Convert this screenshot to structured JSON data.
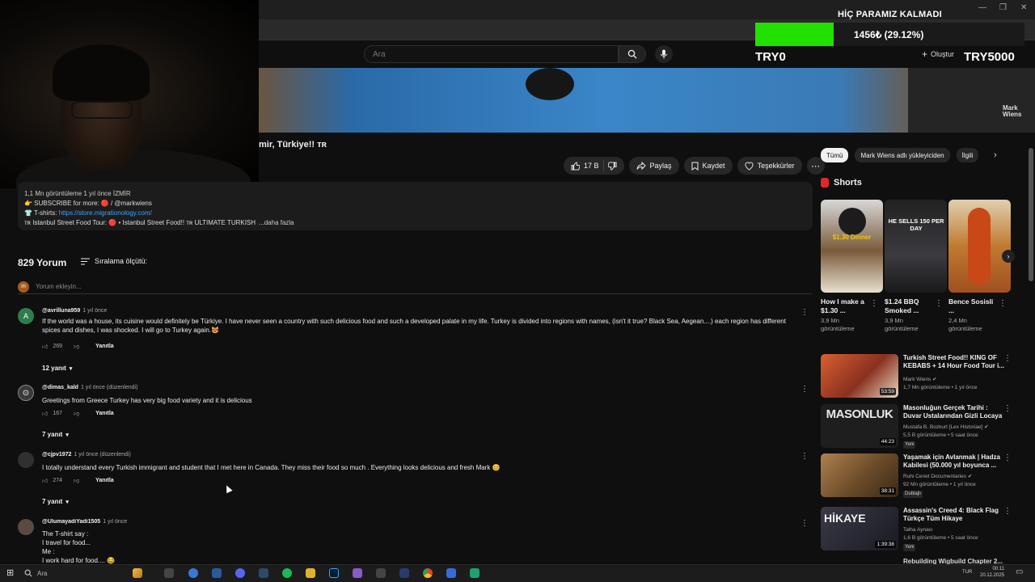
{
  "header": {
    "search_placeholder": "Ara",
    "create_label": "Oluştur"
  },
  "donation": {
    "title": "HİÇ PARAMIZ KALMADI",
    "amount": "1456₺ (29.12%)",
    "progress_fraction": 0.2912,
    "min_label": "TRY0",
    "max_label": "TRY5000",
    "bar_color": "#22e000"
  },
  "video": {
    "watermark": "Mark\nWiens",
    "title": "mir, Türkiye!! ᴛʀ"
  },
  "actions": {
    "likes": "17 B",
    "share": "Paylaş",
    "save": "Kaydet",
    "thanks": "Teşekkürler"
  },
  "description": {
    "meta": "1,1 Mn görüntüleme  1 yıl önce  İZMİR",
    "line1": "👉 SUBSCRIBE for more: 🔴 / @markwiens",
    "line2_label": "👕 T-shirts: ",
    "line2_link": "https://store.migrationology.com/",
    "line3": "ᴛʀ Istanbul Street Food Tour: 🔴 • Istanbul Street Food!! ᴛʀ ULTIMATE TURKISH",
    "more": "...daha fazla"
  },
  "comments": {
    "count_label": "829 Yorum",
    "sort_label": "Sıralama ölçütü:",
    "add_placeholder": "Yorum ekleyin...",
    "user_initial": "m",
    "reply_label": "Yanıtla",
    "items": [
      {
        "initial": "A",
        "author": "@avrilluna959",
        "time": "1 yıl önce",
        "text": "If the world was a house, its cuisine would definitely be Türkiye. I have never seen a country with such delicious food and such a developed palate in my life. Turkey is divided into regions with names, (isn't it true? Black Sea, Aegean....) each region has different spices and dishes, I was shocked. I will go to Turkey again.😻",
        "likes": "269",
        "replies": "12 yanıt",
        "color": "#2e7d4f"
      },
      {
        "initial": "",
        "author": "@dimas_kald",
        "time": "1 yıl önce (düzenlendi)",
        "text": "Greetings from Greece Turkey has very big food  variety and it is delicious",
        "likes": "167",
        "replies": "7 yanıt",
        "color": "#3a3a3a"
      },
      {
        "initial": "",
        "author": "@cjpv1972",
        "time": "1 yıl önce (düzenlendi)",
        "text": "I totally understand every Turkish immigrant and student that I met here in Canada.  They miss their food so much . Everything looks delicious and fresh Mark 😊",
        "likes": "274",
        "replies": "7 yanıt",
        "color": "#3a3a3a"
      },
      {
        "initial": "",
        "author": "@UlumayadiYadi1505",
        "time": "1 yıl önce",
        "text": "The T-shirt say :\nI travel for food...\nMe :\nI work hard for food.... 😂",
        "likes": "",
        "replies": "",
        "color": "#5a4a40"
      }
    ]
  },
  "sidebar": {
    "chips": [
      "Tümü",
      "Mark Wiens adlı yükleyiciden",
      "İlgili"
    ],
    "shorts_title": "Shorts",
    "shorts": [
      {
        "title": "How I make a $1.30 ...",
        "views": "3,9 Mn görüntüleme",
        "thumb_text": "$1.30 Dinner",
        "color": "#5a3a20"
      },
      {
        "title": "$1.24 BBQ Smoked ...",
        "views": "3,9 Mn görüntüleme",
        "thumb_text": "HE SELLS 150 PER DAY",
        "color": "#2a2a30"
      },
      {
        "title": "Bence Sosisli ...",
        "views": "2,4 Mn görüntüleme",
        "thumb_text": "",
        "color": "#8a6a3a"
      }
    ],
    "recommended": [
      {
        "title": "Turkish Street Food!! KING OF KEBABS + 14 Hour Food Tour i...",
        "channel": "Mark Wiens ✔",
        "meta": "1,7 Mn görüntüleme • 1 yıl önce",
        "badge": "",
        "duration": "53:59",
        "thumb_color": "#b85030",
        "thumb_text": ""
      },
      {
        "title": "Masonluğun Gerçek Tarihi : Duvar Ustalarından Gizli Locaya",
        "channel": "Mustafa B. Bozkurt [Lex Historiae] ✔",
        "meta": "5,5 B görüntüleme • 5 saat önce",
        "badge": "Yeni",
        "duration": "44:23",
        "thumb_color": "#2a2a2a",
        "thumb_text": "MASONLUK"
      },
      {
        "title": "Yaşamak için Avlanmak | Hadza Kabilesi (50.000 yıl boyunca ...",
        "channel": "Ruhi Cenet Documentaries ✔",
        "meta": "92 Mn görüntüleme • 1 yıl önce",
        "badge": "Dublajlı",
        "duration": "38:31",
        "thumb_color": "#7a5a30",
        "thumb_text": ""
      },
      {
        "title": "Assassin's Creed 4: Black Flag Türkçe Tüm Hikaye",
        "channel": "Talha Aynacı",
        "meta": "1,6 B görüntüleme • 5 saat önce",
        "badge": "Yeni",
        "duration": "1:39:38",
        "thumb_color": "#303040",
        "thumb_text": "HİKAYE"
      }
    ],
    "cutoff_title": "Rebuilding Wigbuild Chapter 2..."
  },
  "taskbar": {
    "search_label": "Ara",
    "time": "00:11",
    "date": "20.12.2025",
    "lang": "TUR"
  }
}
